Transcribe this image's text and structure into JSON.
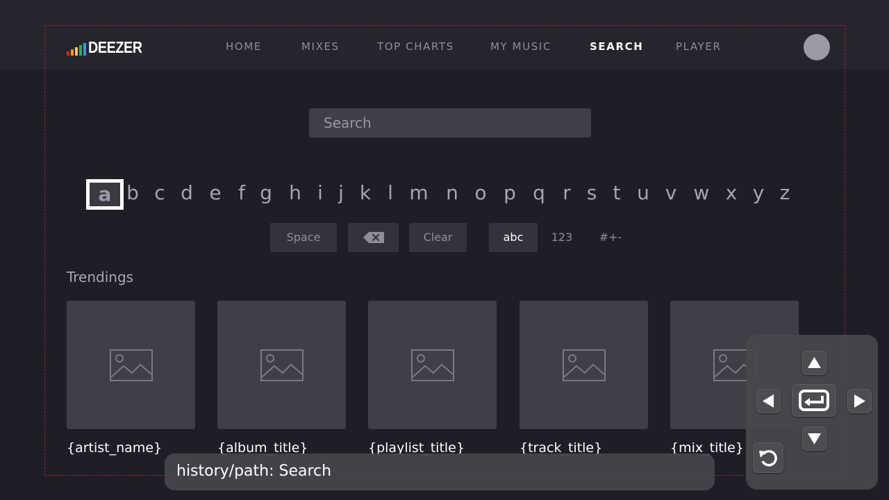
{
  "app": {
    "logo_text": "DEEZER",
    "logo_bars": [
      "#e5242b",
      "#f39c12",
      "#f2c94c",
      "#27ae60",
      "#2d9cdb",
      "#9b51e0",
      "#eb5757"
    ]
  },
  "nav": {
    "items": [
      {
        "label": "HOME",
        "active": false
      },
      {
        "label": "MIXES",
        "active": false
      },
      {
        "label": "TOP CHARTS",
        "active": false
      },
      {
        "label": "MY MUSIC",
        "active": false
      },
      {
        "label": "SEARCH",
        "active": true
      },
      {
        "label": "PLAYER",
        "active": false
      }
    ]
  },
  "search": {
    "placeholder": "Search",
    "value": ""
  },
  "keyboard": {
    "letters": [
      "a",
      "b",
      "c",
      "d",
      "e",
      "f",
      "g",
      "h",
      "i",
      "j",
      "k",
      "l",
      "m",
      "n",
      "o",
      "p",
      "q",
      "r",
      "s",
      "t",
      "u",
      "v",
      "w",
      "x",
      "y",
      "z"
    ],
    "focused_key": "a",
    "space_label": "Space",
    "backspace_icon": "backspace-icon",
    "clear_label": "Clear",
    "modes": [
      {
        "label": "abc",
        "selected": true
      },
      {
        "label": "123",
        "selected": false
      },
      {
        "label": "#+-",
        "selected": false
      }
    ]
  },
  "trendings": {
    "title": "Trendings",
    "items": [
      {
        "label": "{artist_name}",
        "icon": "image-placeholder-icon"
      },
      {
        "label": "{album_title}",
        "icon": "image-placeholder-icon"
      },
      {
        "label": "{playlist_title}",
        "icon": "image-placeholder-icon"
      },
      {
        "label": "{track_title}",
        "icon": "image-placeholder-icon"
      },
      {
        "label": "{mix_title}",
        "icon": "image-placeholder-icon"
      }
    ]
  },
  "history": {
    "text": "history/path: Search"
  },
  "remote": {
    "buttons": [
      "up-arrow-icon",
      "left-arrow-icon",
      "enter-icon",
      "right-arrow-icon",
      "down-arrow-icon",
      "back-icon"
    ]
  },
  "colors": {
    "background": "#1e1e27",
    "topbar": "#25252e",
    "card": "#3f3f48",
    "guide_border": "#a0202c"
  }
}
